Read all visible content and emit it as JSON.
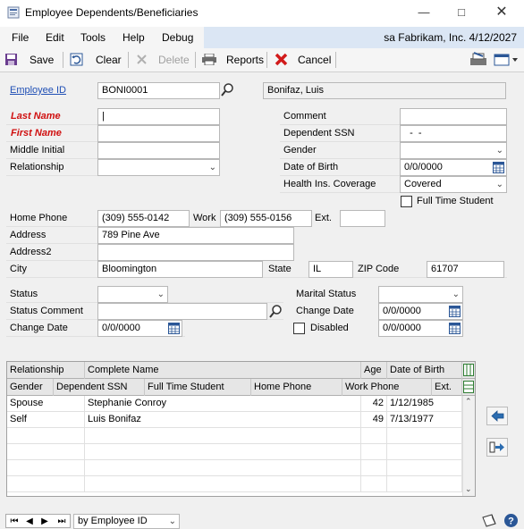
{
  "window": {
    "title": "Employee Dependents/Beneficiaries"
  },
  "menu": {
    "items": [
      "File",
      "Edit",
      "Tools",
      "Help",
      "Debug"
    ],
    "status": "sa  Fabrikam, Inc.  4/12/2027"
  },
  "toolbar": {
    "save": "Save",
    "clear": "Clear",
    "delete": "Delete",
    "reports": "Reports",
    "cancel": "Cancel"
  },
  "form": {
    "employee_id_label": "Employee ID",
    "employee_id": "BONI0001",
    "employee_name": "Bonifaz, Luis",
    "last_name_label": "Last Name",
    "last_name": "|",
    "first_name_label": "First Name",
    "first_name": "",
    "middle_initial_label": "Middle Initial",
    "relationship_label": "Relationship",
    "comment_label": "Comment",
    "dependent_ssn_label": "Dependent SSN",
    "dependent_ssn": "  -  -",
    "gender_label": "Gender",
    "dob_label": "Date of Birth",
    "dob": "0/0/0000",
    "health_label": "Health Ins. Coverage",
    "health": "Covered",
    "fulltime_label": "Full Time Student",
    "home_phone_label": "Home Phone",
    "home_phone": "(309) 555-0142",
    "work_label": "Work",
    "work_phone": "(309) 555-0156",
    "ext_label": "Ext.",
    "address_label": "Address",
    "address": "789 Pine Ave",
    "address2_label": "Address2",
    "city_label": "City",
    "city": "Bloomington",
    "state_label": "State",
    "state": "IL",
    "zip_label": "ZIP Code",
    "zip": "61707",
    "status_label": "Status",
    "status_comment_label": "Status Comment",
    "change_date_label": "Change Date",
    "change_date": "0/0/0000",
    "marital_label": "Marital Status",
    "marital_change_label": "Change Date",
    "marital_change": "0/0/0000",
    "disabled_label": "Disabled",
    "disabled_date": "0/0/0000"
  },
  "grid": {
    "header1": [
      "Relationship",
      "Complete Name",
      "Age",
      "Date of Birth"
    ],
    "header2": [
      "Gender",
      "Dependent SSN",
      "Full Time Student",
      "Home Phone",
      "Work Phone",
      "Ext."
    ],
    "rows": [
      {
        "relationship": "Spouse",
        "name": "Stephanie Conroy",
        "age": "42",
        "dob": "1/12/1985"
      },
      {
        "relationship": "Self",
        "name": "Luis Bonifaz",
        "age": "49",
        "dob": "7/13/1977"
      }
    ]
  },
  "footer": {
    "sort": "by Employee ID"
  }
}
